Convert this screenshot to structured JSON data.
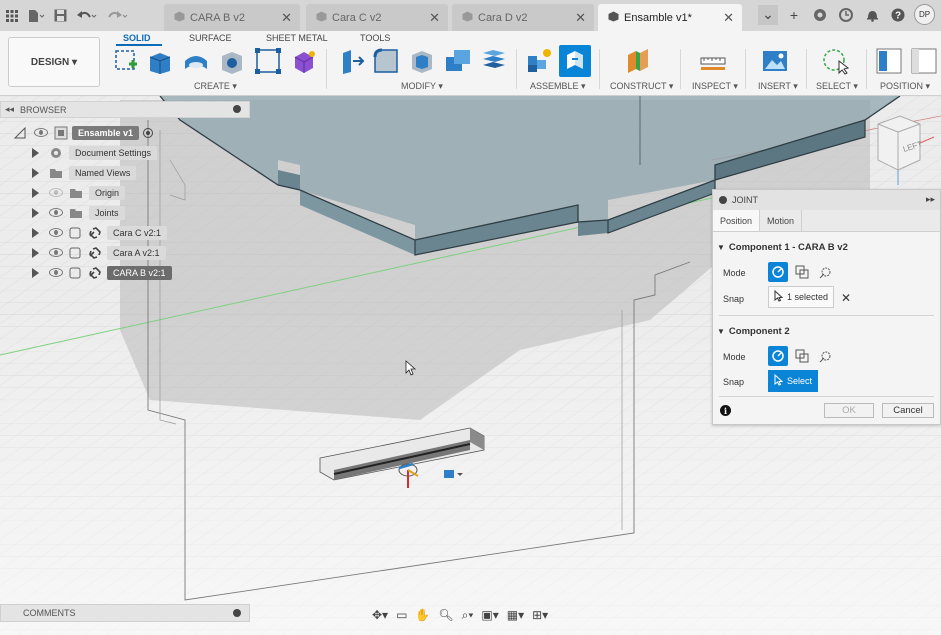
{
  "tabs": [
    {
      "label": "CARA B v2",
      "active": false
    },
    {
      "label": "Cara C v2",
      "active": false
    },
    {
      "label": "Cara D v2",
      "active": false
    },
    {
      "label": "Ensamble v1*",
      "active": true
    }
  ],
  "user_initials": "DP",
  "toolbar": {
    "design_label": "DESIGN",
    "workspace_tabs": [
      "SOLID",
      "SURFACE",
      "SHEET METAL",
      "TOOLS"
    ],
    "groups": [
      "CREATE",
      "MODIFY",
      "ASSEMBLE",
      "CONSTRUCT",
      "INSPECT",
      "INSERT",
      "SELECT",
      "POSITION"
    ]
  },
  "browser": {
    "title": "BROWSER",
    "root": "Ensamble v1",
    "items": [
      {
        "label": "Document Settings",
        "icon": "gear-icon"
      },
      {
        "label": "Named Views",
        "icon": "folder-icon"
      },
      {
        "label": "Origin",
        "icon": "folder-icon"
      },
      {
        "label": "Joints",
        "icon": "folder-icon"
      },
      {
        "label": "Cara C v2:1",
        "icon": "link-icon"
      },
      {
        "label": "Cara A v2:1",
        "icon": "link-icon"
      },
      {
        "label": "CARA B v2:1",
        "icon": "link-icon"
      }
    ]
  },
  "joint": {
    "title": "JOINT",
    "tabs": [
      "Position",
      "Motion"
    ],
    "component1": "Component 1 - CARA B v2",
    "component2": "Component 2",
    "mode_label": "Mode",
    "snap_label": "Snap",
    "snap1_value": "1 selected",
    "snap2_value": "Select",
    "ok_label": "OK",
    "cancel_label": "Cancel"
  },
  "viewcube_face": "LEFT",
  "comments_label": "COMMENTS",
  "colors": {
    "accent": "#0a84d6",
    "model_top": "#8fa6ae",
    "model_edge": "#2f3e44"
  }
}
